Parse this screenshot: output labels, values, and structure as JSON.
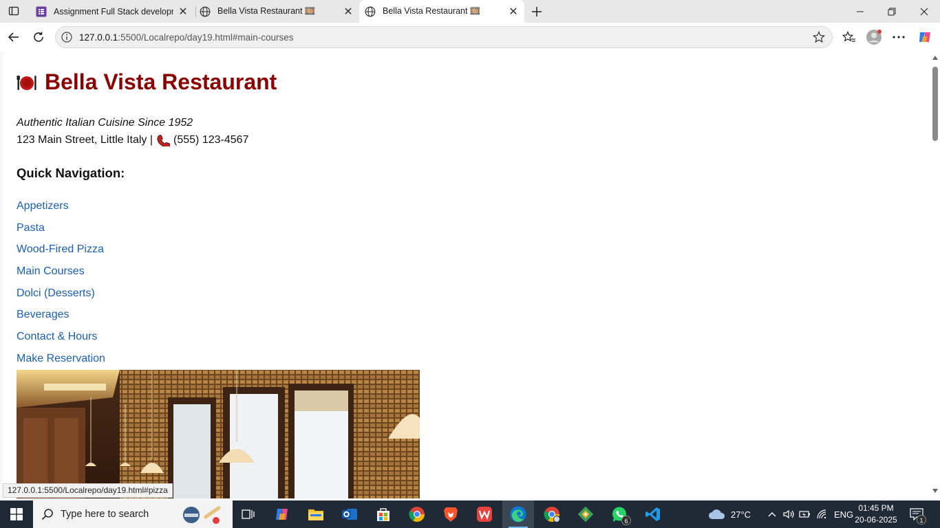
{
  "browser": {
    "tabs": [
      {
        "title": "Assignment Full Stack developme",
        "favicon": "forms-icon",
        "active": false
      },
      {
        "title": "Bella Vista Restaurant 🎞️",
        "favicon": "globe-icon",
        "active": false
      },
      {
        "title": "Bella Vista Restaurant 🎞️",
        "favicon": "globe-icon",
        "active": true
      }
    ],
    "url_host": "127.0.0.1",
    "url_rest": ":5500/Localrepo/day19.html#main-courses",
    "status_url": "127.0.0.1:5500/Localrepo/day19.html#pizza"
  },
  "page": {
    "title": "Bella Vista Restaurant",
    "title_icon": "plate-icon",
    "tagline": "Authentic Italian Cuisine Since 1952",
    "address_prefix": "123 Main Street, Little Italy |",
    "phone": "(555) 123-4567",
    "nav_heading": "Quick Navigation:",
    "nav_links": [
      "Appetizers",
      "Pasta",
      "Wood-Fired Pizza",
      "Main Courses",
      "Dolci (Desserts)",
      "Beverages",
      "Contact & Hours",
      "Make Reservation"
    ],
    "colors": {
      "title": "#8b0000",
      "link": "#1a5fb4"
    }
  },
  "taskbar": {
    "search_placeholder": "Type here to search",
    "weather": "27°C",
    "language": "ENG",
    "time": "01:45 PM",
    "date": "20-06-2025",
    "whatsapp_badge": "6",
    "notification_badge": "1"
  }
}
